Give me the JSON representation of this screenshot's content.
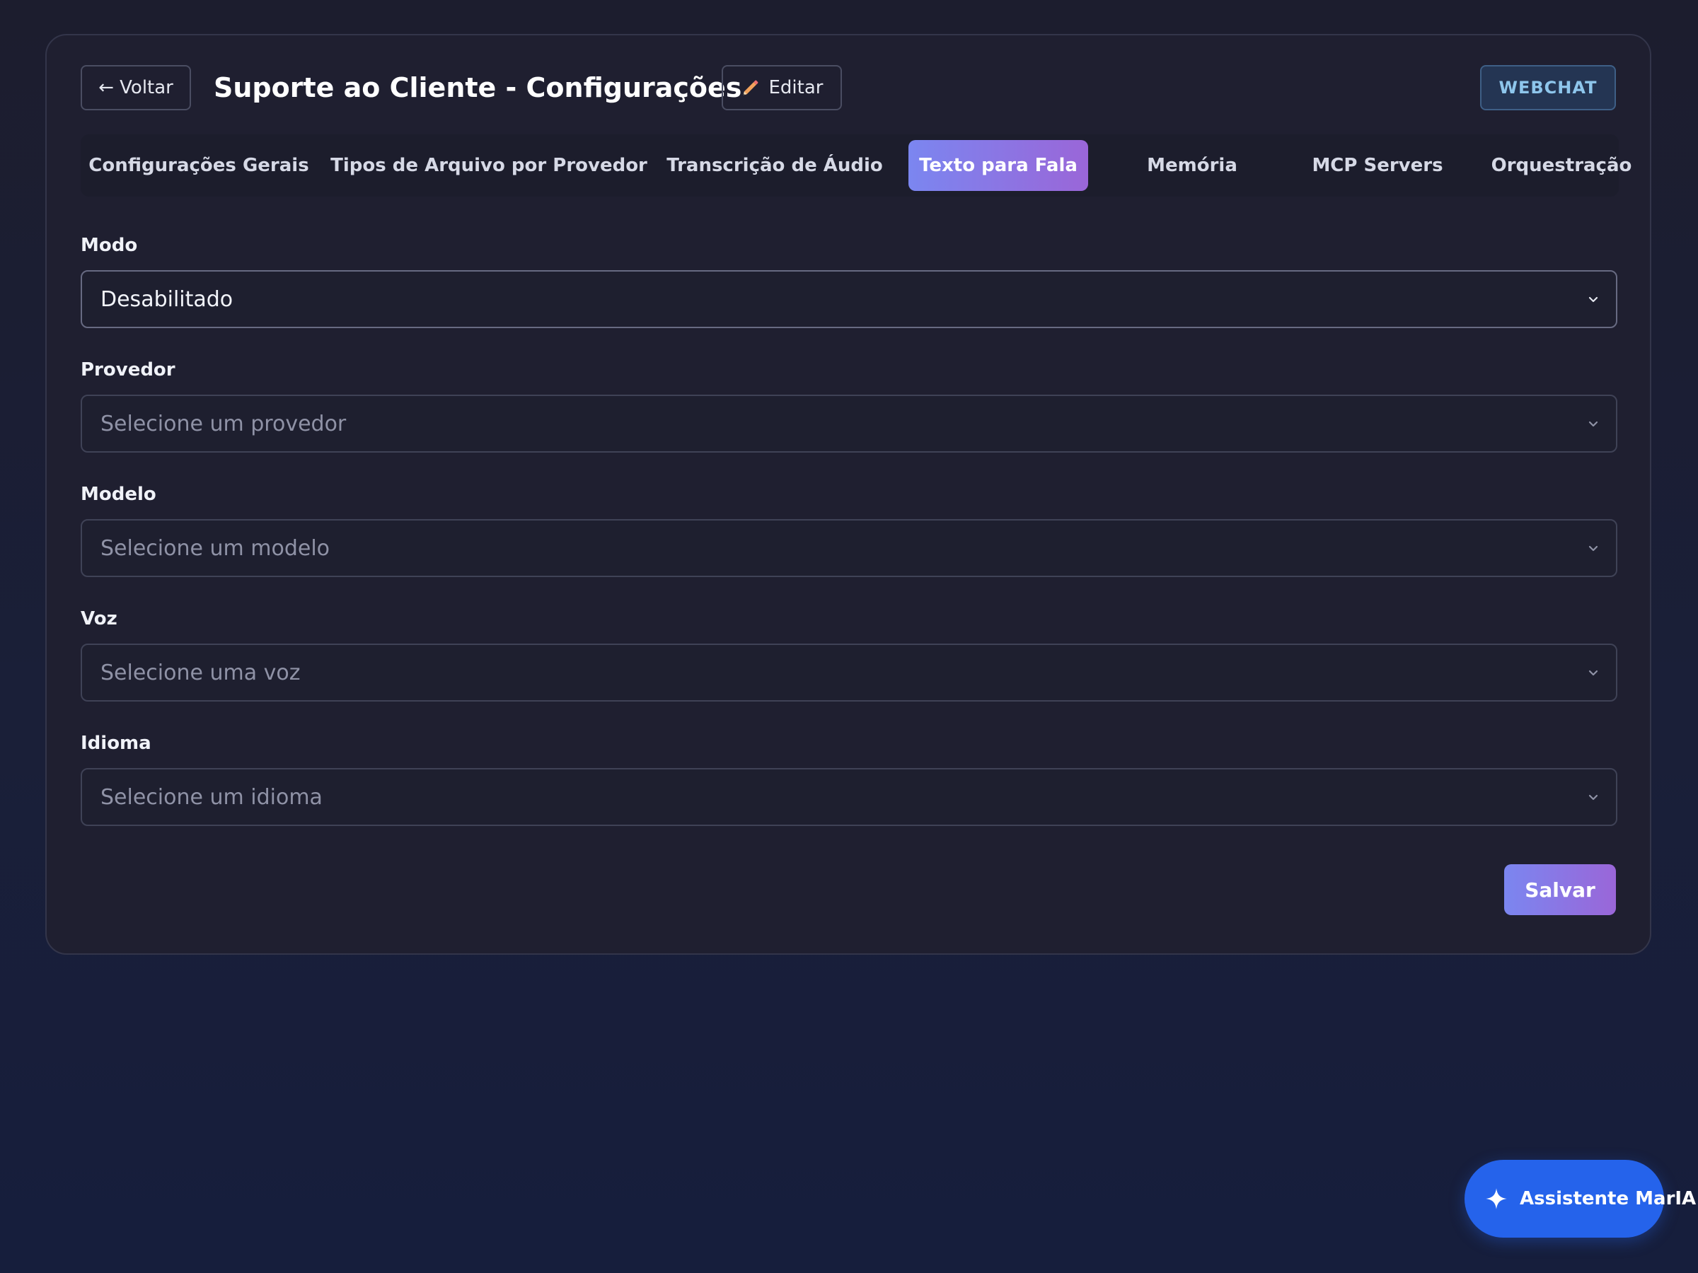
{
  "header": {
    "back_label": "← Voltar",
    "title": "Suporte ao Cliente - Configurações",
    "edit_label": "Editar",
    "channel_badge": "WEBCHAT"
  },
  "tabs": [
    {
      "label": "Configurações Gerais",
      "active": false
    },
    {
      "label": "Tipos de Arquivo por Provedor",
      "active": false
    },
    {
      "label": "Transcrição de Áudio",
      "active": false
    },
    {
      "label": "Texto para Fala",
      "active": true
    },
    {
      "label": "Memória",
      "active": false
    },
    {
      "label": "MCP Servers",
      "active": false
    },
    {
      "label": "Orquestração",
      "active": false
    }
  ],
  "form": {
    "mode": {
      "label": "Modo",
      "value": "Desabilitado"
    },
    "provider": {
      "label": "Provedor",
      "placeholder": "Selecione um provedor"
    },
    "model": {
      "label": "Modelo",
      "placeholder": "Selecione um modelo"
    },
    "voice": {
      "label": "Voz",
      "placeholder": "Selecione uma voz"
    },
    "language": {
      "label": "Idioma",
      "placeholder": "Selecione um idioma"
    }
  },
  "actions": {
    "save_label": "Salvar"
  },
  "assistant": {
    "label": "Assistente MarIA"
  },
  "colors": {
    "accent_gradient_start": "#7b86f0",
    "accent_gradient_end": "#9a66d8",
    "assistant_blue": "#2563eb",
    "badge_text": "#8ec6ec"
  },
  "icons": {
    "edit": "pencil-icon",
    "select_toggle": "chevron-down-icon",
    "assistant": "sparkle-icon"
  }
}
